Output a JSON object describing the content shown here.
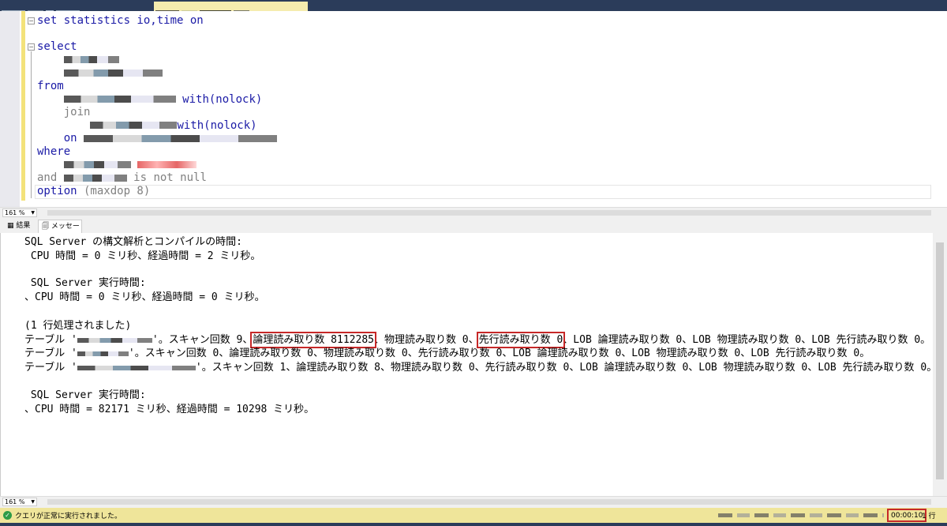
{
  "editor": {
    "lines": {
      "l1": "set statistics io,time on",
      "select": "select",
      "from": "from",
      "with1": "with(nolock)",
      "join": "join",
      "with2": "with(nolock)",
      "on": "on",
      "where": "where",
      "and": "and",
      "notnull": " is not null",
      "option": "option",
      "maxdop": " (maxdop 8)"
    },
    "zoom": "161 %"
  },
  "results_tabs": [
    {
      "label": "結果",
      "icon": "grid-icon"
    },
    {
      "label": "メッセージ",
      "icon": "message-icon"
    }
  ],
  "messages": {
    "m1": "SQL Server の構文解析とコンパイルの時間:",
    "m2": " CPU 時間 = 0 ミリ秒、経過時間 = 2 ミリ秒。",
    "m3": " SQL Server 実行時間:",
    "m4": "、CPU 時間 = 0 ミリ秒、経過時間 = 0 ミリ秒。",
    "m5": "(1 行処理されました)",
    "t1a": "テーブル '",
    "t1b": "'。スキャン回数 9、",
    "t1logical": "論理読み取り数 8112285",
    "t1c": "、物理読み取り数 0、",
    "t1readahead": "先行読み取り数 0",
    "t1d": "、LOB 論理読み取り数 0、LOB 物理読み取り数 0、LOB 先行読み取り数 0。",
    "t2a": "テーブル '",
    "t2b": "'。スキャン回数 0、論理読み取り数 0、物理読み取り数 0、先行読み取り数 0、LOB 論理読み取り数 0、LOB 物理読み取り数 0、LOB 先行読み取り数 0。",
    "t3a": "テーブル '",
    "t3b": "'。スキャン回数 1、論理読み取り数 8、物理読み取り数 0、先行読み取り数 0、LOB 論理読み取り数 0、LOB 物理読み取り数 0、LOB 先行読み取り数 0。",
    "m6": " SQL Server 実行時間:",
    "m7": "、CPU 時間 = 82171 ミリ秒、経過時間 = 10298 ミリ秒。"
  },
  "results_zoom": "161 %",
  "status": {
    "message": "クエリが正常に実行されました。",
    "elapsed": "00:00:10",
    "rows": "1 行",
    "icon": "check-circle-icon"
  },
  "colors": {
    "status_bar": "#efe59a",
    "highlight": "#c62828",
    "keyword": "#1a1aa6"
  }
}
